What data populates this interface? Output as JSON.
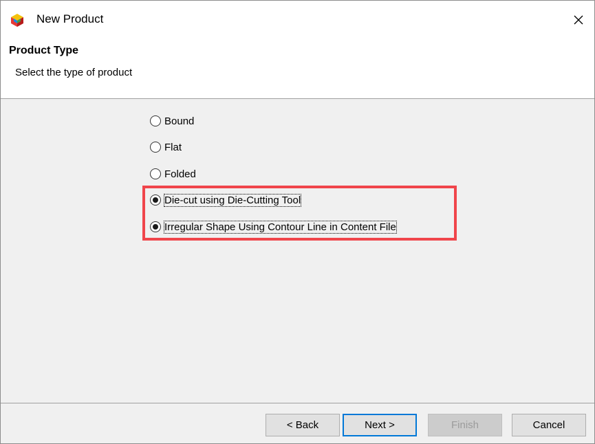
{
  "window": {
    "title": "New Product",
    "app_icon": "colorful-cube-logo-icon",
    "close_icon": "close-icon"
  },
  "header": {
    "title": "Product Type",
    "description": "Select the type of product"
  },
  "options": [
    {
      "label": "Bound",
      "checked": false
    },
    {
      "label": "Flat",
      "checked": false
    },
    {
      "label": "Folded",
      "checked": false
    },
    {
      "label": "Die-cut using Die-Cutting Tool",
      "checked": true
    },
    {
      "label": "Irregular Shape Using Contour Line in Content File",
      "checked": true
    }
  ],
  "highlight_color": "#f0454b",
  "buttons": {
    "back": "< Back",
    "next": "Next >",
    "finish": "Finish",
    "cancel": "Cancel"
  }
}
